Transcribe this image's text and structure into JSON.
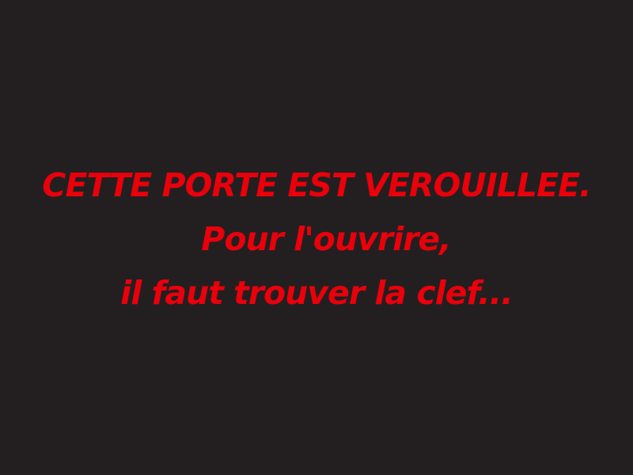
{
  "screen": {
    "background_color": "#231f20",
    "text_color": "#e8000b"
  },
  "message": {
    "line1": "CETTE PORTE EST VEROUILLEE.",
    "line2": "Pour l'ouvrire,",
    "line3": "il faut trouver la clef..."
  }
}
